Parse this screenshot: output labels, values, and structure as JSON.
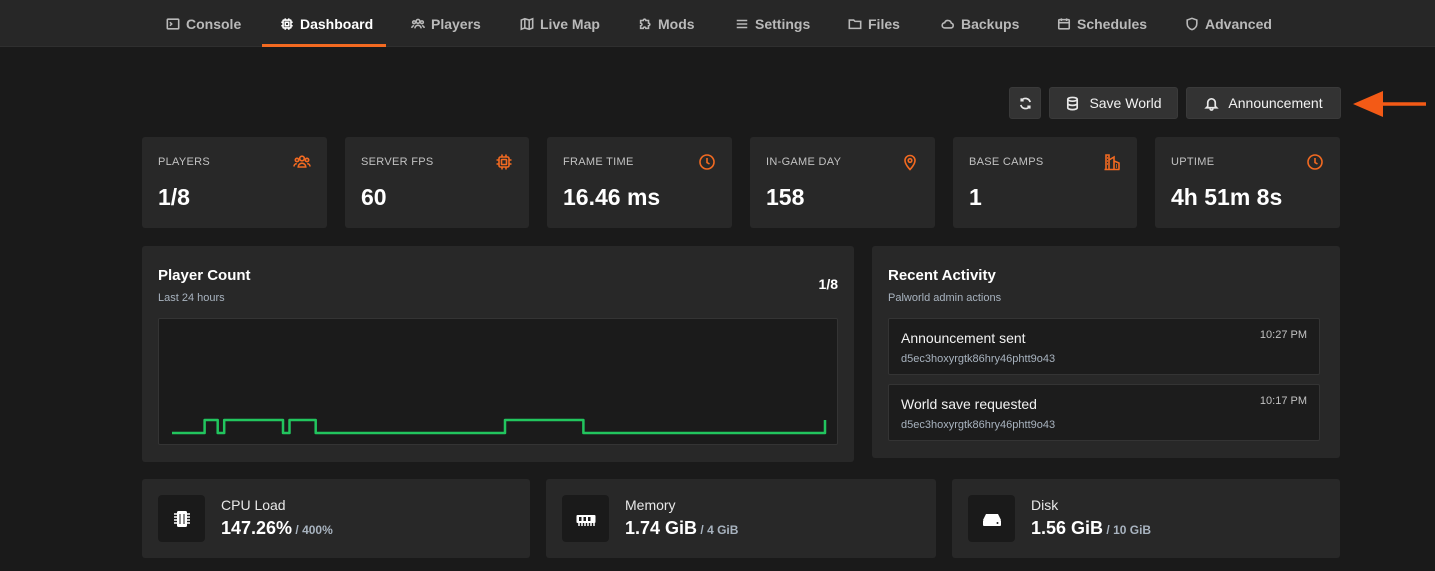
{
  "nav": {
    "tabs": [
      {
        "label": "Console",
        "icon": "terminal-icon"
      },
      {
        "label": "Dashboard",
        "icon": "chip-icon",
        "active": true
      },
      {
        "label": "Players",
        "icon": "users-icon"
      },
      {
        "label": "Live Map",
        "icon": "map-icon"
      },
      {
        "label": "Mods",
        "icon": "puzzle-icon"
      },
      {
        "label": "Settings",
        "icon": "sliders-icon"
      },
      {
        "label": "Files",
        "icon": "folder-icon"
      },
      {
        "label": "Backups",
        "icon": "cloud-icon"
      },
      {
        "label": "Schedules",
        "icon": "calendar-icon"
      },
      {
        "label": "Advanced",
        "icon": "shield-icon"
      }
    ]
  },
  "actions": {
    "refresh_icon": "refresh-icon",
    "save_world_label": "Save World",
    "announcement_label": "Announcement"
  },
  "stats": [
    {
      "label": "PLAYERS",
      "value": "1/8",
      "icon": "users-icon"
    },
    {
      "label": "SERVER FPS",
      "value": "60",
      "icon": "chip-icon"
    },
    {
      "label": "FRAME TIME",
      "value": "16.46 ms",
      "icon": "clock-icon"
    },
    {
      "label": "IN-GAME DAY",
      "value": "158",
      "icon": "map-pin-icon"
    },
    {
      "label": "BASE CAMPS",
      "value": "1",
      "icon": "building-icon"
    },
    {
      "label": "UPTIME",
      "value": "4h 51m 8s",
      "icon": "clock-icon"
    }
  ],
  "player_count": {
    "title": "Player Count",
    "subtitle": "Last 24 hours",
    "current": "1/8"
  },
  "chart_data": {
    "type": "line",
    "title": "Player Count",
    "subtitle": "Last 24 hours",
    "xlabel": "",
    "ylabel": "",
    "ylim": [
      0,
      1
    ],
    "grid": false,
    "legend": "none",
    "line_color": "#22c55e",
    "x": [
      0,
      1,
      2,
      3,
      4,
      5,
      6,
      7,
      8,
      9,
      10,
      11,
      12,
      13,
      14,
      15,
      16,
      17,
      18,
      19,
      20,
      21,
      22,
      23,
      24,
      25,
      26,
      27,
      28,
      29,
      30,
      31,
      32,
      33,
      34,
      35,
      36,
      37,
      38,
      39,
      40,
      41,
      42,
      43,
      44,
      45,
      46,
      47,
      48,
      49,
      50,
      51,
      52,
      53,
      54,
      55,
      56,
      57,
      58,
      59,
      60,
      61,
      62,
      63,
      64,
      65,
      66,
      67,
      68,
      69,
      70,
      71,
      72,
      73,
      74,
      75,
      76,
      77,
      78,
      79,
      80,
      81,
      82,
      83,
      84,
      85,
      86,
      87,
      88,
      89,
      90,
      91,
      92,
      93,
      94,
      95,
      96,
      97,
      98,
      99,
      100
    ],
    "values": [
      0,
      0,
      0,
      0,
      0,
      1,
      1,
      0,
      1,
      1,
      1,
      1,
      1,
      1,
      1,
      1,
      1,
      0,
      1,
      1,
      1,
      1,
      0,
      0,
      0,
      0,
      0,
      0,
      0,
      0,
      0,
      0,
      0,
      0,
      0,
      0,
      0,
      0,
      0,
      0,
      0,
      0,
      0,
      0,
      0,
      0,
      0,
      0,
      0,
      0,
      0,
      1,
      1,
      1,
      1,
      1,
      1,
      1,
      1,
      1,
      1,
      1,
      1,
      0,
      0,
      0,
      0,
      0,
      0,
      0,
      0,
      0,
      0,
      0,
      0,
      0,
      0,
      0,
      0,
      0,
      0,
      0,
      0,
      0,
      0,
      0,
      0,
      0,
      0,
      0,
      0,
      0,
      0,
      0,
      0,
      0,
      0,
      0,
      0,
      0,
      1
    ]
  },
  "recent_activity": {
    "title": "Recent Activity",
    "subtitle": "Palworld admin actions",
    "items": [
      {
        "title": "Announcement sent",
        "id": "d5ec3hoxyrgtk86hry46phtt9o43",
        "time": "10:27 PM"
      },
      {
        "title": "World save requested",
        "id": "d5ec3hoxyrgtk86hry46phtt9o43",
        "time": "10:17 PM"
      }
    ]
  },
  "resources": [
    {
      "label": "CPU Load",
      "value": "147.26%",
      "sep": " / ",
      "total": "400%",
      "icon": "cpu-icon"
    },
    {
      "label": "Memory",
      "value": "1.74 GiB",
      "sep": " / ",
      "total": "4 GiB",
      "icon": "memory-icon"
    },
    {
      "label": "Disk",
      "value": "1.56 GiB",
      "sep": " / ",
      "total": "10 GiB",
      "icon": "hard-drive-icon"
    }
  ],
  "colors": {
    "accent": "#f36a21",
    "chart_line": "#22c55e",
    "annotation_arrow": "#f35a16"
  }
}
